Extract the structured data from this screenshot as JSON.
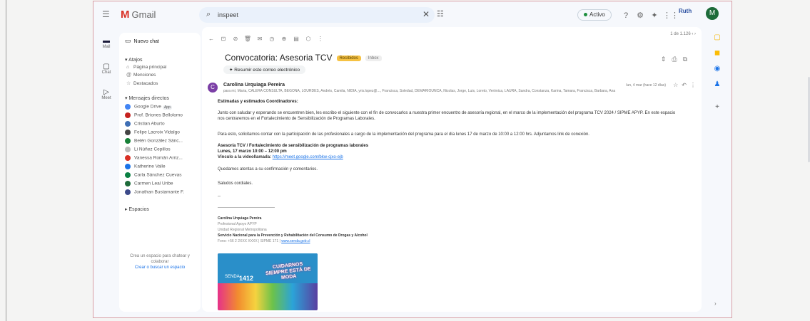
{
  "app": {
    "name": "Gmail"
  },
  "search": {
    "value": "inspeet"
  },
  "status": {
    "label": "Activo"
  },
  "org_logo": "Ruth",
  "account": {
    "initial": "M"
  },
  "rail": [
    {
      "label": "Mail"
    },
    {
      "label": "Chat"
    },
    {
      "label": "Meet"
    }
  ],
  "sidebar": {
    "new_chat": "Nuevo chat",
    "shortcuts_title": "Atajos",
    "shortcuts": [
      {
        "label": "Página principal"
      },
      {
        "label": "Menciones"
      },
      {
        "label": "Destacados"
      }
    ],
    "dm_title": "Mensajes directos",
    "dms": [
      {
        "name": "Google Drive",
        "badge": "App",
        "color": "#4285f4"
      },
      {
        "name": "Prof. Briones Bellolomo",
        "color": "#c5221f"
      },
      {
        "name": "Cristian Aburto",
        "color": "#3f6fb5"
      },
      {
        "name": "Felipe Lacroix Vidalgo",
        "color": "#444"
      },
      {
        "name": "Belén González Sánc...",
        "color": "#188038"
      },
      {
        "name": "Li Núñez Cepillos",
        "color": "#bbb"
      },
      {
        "name": "Vanessa Román Arriz...",
        "color": "#d93025"
      },
      {
        "name": "Katherine Valle",
        "color": "#1a73e8"
      },
      {
        "name": "Carla Sánchez Cuevas",
        "color": "#0b8043"
      },
      {
        "name": "Carmen Leal Uribe",
        "color": "#1e6b3a"
      },
      {
        "name": "Jonathan Bustamante F.",
        "color": "#3c4a8a"
      }
    ],
    "spaces_title": "Espacios",
    "empty_note": "Crea un espacio para chatear y colaborar",
    "empty_link": "Crear o buscar un espacio"
  },
  "toolbar": {
    "pager": "1 de 1.126"
  },
  "email": {
    "subject": "Convocatoria: Asesoria TCV",
    "labels": [
      "Recibidos",
      "Inbox"
    ],
    "summary_chip": "Resumir este correo electrónico",
    "sender_initial": "C",
    "sender": "Carolina Urquiaga Pereira",
    "recipients": "para mí, Maria, CALERA CONSULTA, BEGOÑA, LOURDES, Andrés, Camila, NIDIA, yris.lopez@..., Francisca, Soledad, DEMARIOUNCA, Nicolas, Jorge, Luis, Loreto, Verónica, LAURA, Sandra, Constanza, Karina, Tamara, Francisca, Barbara, Ana",
    "date": "lun, 4 mar (hace 12 días)",
    "greeting": "Estimadas y estimados Coordinadores:",
    "p1": "Junto con saludar y esperando se encuentren bien, les escribo el siguiente con el fin de convocarlos a nuestra primer encuentro de asesoría regional, en el marco de la implementación del programa TCV 2024 / SIPME APYP. En este espacio nos centraremos en el Fortalecimiento de Sensibilización de Programas Laborales.",
    "p2": "Para esto, solicitamos contar con la participación de las profesionales a cargo de la implementación del programa para el día lunes 17 de marzo de 10:00 a 12:00 hrs. Adjuntamos link de conexión.",
    "event_title": "Asesoría TCV / Fortalecimiento de sensibilización de programas laborales",
    "event_time": "Lunes, 17 marzo 10:00 – 12:00 pm",
    "event_link_label": "Vínculo a la videollamada:",
    "event_link": "https://meet.google.com/bkw-cjxo-ejb",
    "p3": "Quedamos atentas a su confirmación y comentarios.",
    "closing": "Saludos cordiales.",
    "dash": "--",
    "sig": {
      "name": "Carolina Urquiaga Pereira",
      "role": "Profesional Apoyo APYP",
      "unit": "Unidad Regional Metropolitana",
      "org": "Servicio Nacional para la Prevención y Rehabilitación del Consumo de Drogas y Alcohol",
      "contact": "Fono: +56 2 2XXX XXXX | SIPME 171 |",
      "web": "www.senda.gob.cl"
    },
    "banner": {
      "title": "CUIDARNOS SIEMPRE ESTÁ DE MODA",
      "number": "1412",
      "logo": "SENDA"
    }
  }
}
